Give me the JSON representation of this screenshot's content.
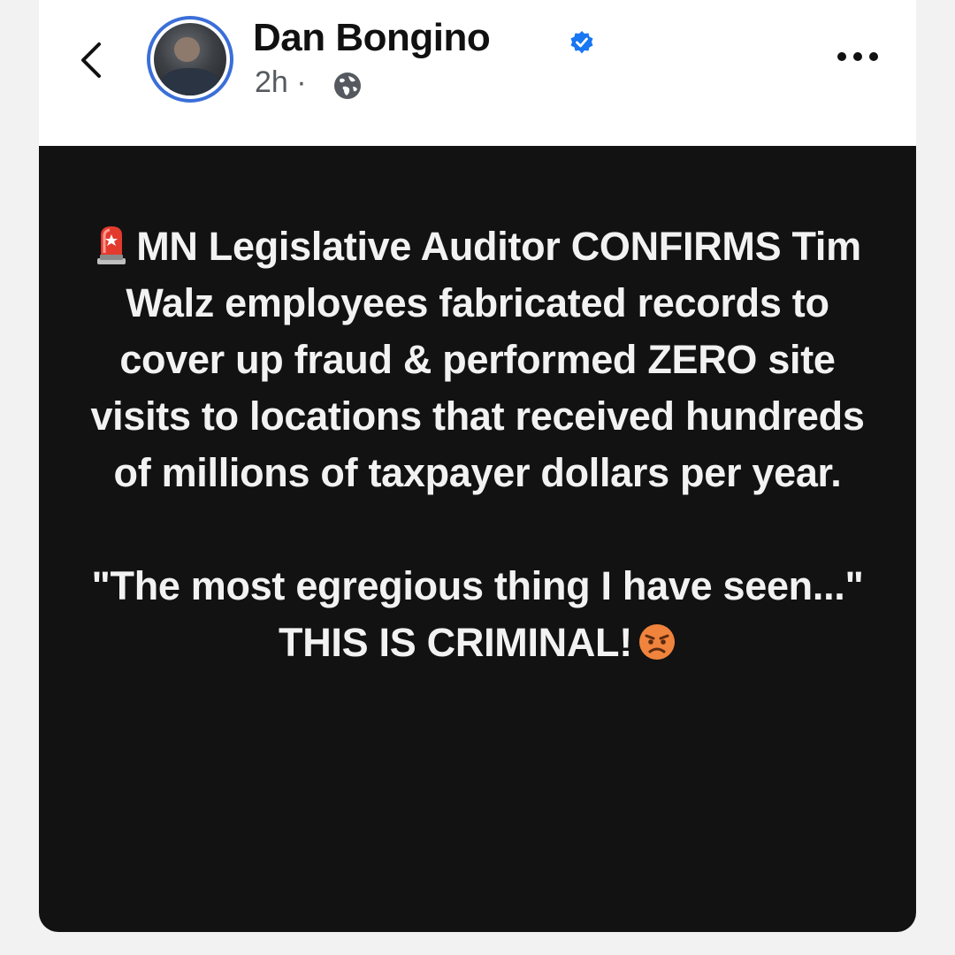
{
  "post": {
    "author": "Dan Bongino",
    "verified": true,
    "time": "2h",
    "separator": "·",
    "audience_icon": "globe-icon",
    "lead_emoji": "police-siren-icon",
    "paragraph1": "MN Legislative Auditor CONFIRMS Tim Walz employees fabricated records to cover up fraud & performed ZERO site visits to locations that received hundreds of millions of taxpayer dollars per year.",
    "paragraph2": "\"The most egregious thing I have seen...\" THIS IS CRIMINAL!",
    "trailing_emoji": "angry-face-icon"
  },
  "header": {
    "back_icon": "chevron-left-icon",
    "more_icon": "more-options-icon"
  },
  "colors": {
    "verified_badge": "#1877f2",
    "avatar_ring": "#3b6fd8",
    "post_background": "#121212",
    "post_text": "#f2f2f2"
  }
}
